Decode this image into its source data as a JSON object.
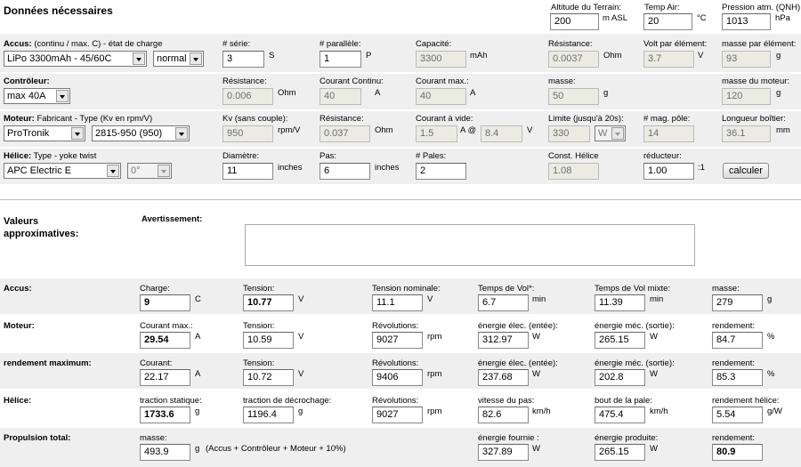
{
  "top": {
    "title": "Données nécessaires",
    "altitude_label": "Altitude du Terrain:",
    "altitude_value": "200",
    "altitude_unit": "m ASL",
    "temp_label": "Temp Air:",
    "temp_value": "20",
    "temp_unit": "°C",
    "pressure_label": "Pression atm. (QNH):",
    "pressure_value": "1013",
    "pressure_unit": "hPa"
  },
  "accus": {
    "label": "Accus:",
    "label_sub": "(continu / max. C) - état de charge",
    "battery_select": "LiPo 3300mAh - 45/60C",
    "state_select": "normal",
    "serie_label": "# série:",
    "serie_value": "3",
    "serie_unit": "S",
    "parallel_label": "# parallèle:",
    "parallel_value": "1",
    "parallel_unit": "P",
    "capacity_label": "Capacité:",
    "capacity_value": "3300",
    "capacity_unit": "mAh",
    "resistance_label": "Résistance:",
    "resistance_value": "0.0037",
    "resistance_unit": "Ohm",
    "volt_label": "Volt par élément:",
    "volt_value": "3.7",
    "volt_unit": "V",
    "mass_label": "masse par élément:",
    "mass_value": "93",
    "mass_unit": "g"
  },
  "controller": {
    "label": "Contrôleur:",
    "select": "max 40A",
    "resistance_label": "Résistance:",
    "resistance_value": "0.006",
    "resistance_unit": "Ohm",
    "current_label": "Courant Continu:",
    "current_value": "40",
    "current_unit": "A",
    "current_max_label": "Courant max.:",
    "current_max_value": "40",
    "current_max_unit": "A",
    "mass_label": "masse:",
    "mass_value": "50",
    "mass_unit": "g",
    "motor_mass_label": "masse du moteur:",
    "motor_mass_value": "120",
    "motor_mass_unit": "g"
  },
  "motor": {
    "label": "Moteur:",
    "label_sub": "Fabricant - Type (Kv en rpm/V)",
    "maker_select": "ProTronik",
    "type_select": "2815-950 (950)",
    "kv_label": "Kv (sans couple):",
    "kv_value": "950",
    "kv_unit": "rpm/V",
    "resistance_label": "Résistance:",
    "resistance_value": "0.037",
    "resistance_unit": "Ohm",
    "noload_label": "Courant à vide:",
    "noload_current": "1.5",
    "noload_at": "A @",
    "noload_voltage": "8.4",
    "noload_voltage_unit": "V",
    "limit_label": "Limite (jusqu'à 20s):",
    "limit_value": "330",
    "limit_select": "W",
    "poles_label": "# mag. pôle:",
    "poles_value": "14",
    "length_label": "Longueur boîtier:",
    "length_value": "36.1",
    "length_unit": "mm"
  },
  "prop": {
    "label": "Hélice:",
    "label_sub": "Type - yoke twist",
    "type_select": "APC Electric E",
    "twist_select": "0°",
    "diameter_label": "Diamètre:",
    "diameter_value": "11",
    "diameter_unit": "inches",
    "pitch_label": "Pas:",
    "pitch_value": "6",
    "pitch_unit": "inches",
    "blades_label": "# Pales:",
    "blades_value": "2",
    "const_label": "Const. Hélice",
    "const_value": "1.08",
    "gear_label": "réducteur:",
    "gear_value": "1.00",
    "gear_unit": ":1",
    "calc_button": "calculer"
  },
  "results": {
    "title": "Valeurs approximatives:",
    "warning_label": "Avertissement:",
    "accus": {
      "label": "Accus:",
      "charge_label": "Charge:",
      "charge_value": "9",
      "charge_unit": "C",
      "tension_label": "Tension:",
      "tension_value": "10.77",
      "tension_unit": "V",
      "nominal_label": "Tension nominale:",
      "nominal_value": "11.1",
      "nominal_unit": "V",
      "flight_label": "Temps de Vol*:",
      "flight_value": "6.7",
      "flight_unit": "min",
      "mixed_label": "Temps de Vol mixte:",
      "mixed_value": "11.39",
      "mixed_unit": "min",
      "mass_label": "masse:",
      "mass_value": "279",
      "mass_unit": "g"
    },
    "motor": {
      "label": "Moteur:",
      "current_label": "Courant max.:",
      "current_value": "29.54",
      "current_unit": "A",
      "tension_label": "Tension:",
      "tension_value": "10.59",
      "tension_unit": "V",
      "rev_label": "Révolutions:",
      "rev_value": "9027",
      "rev_unit": "rpm",
      "elec_label": "énergie élec. (entée):",
      "elec_value": "312.97",
      "elec_unit": "W",
      "mech_label": "énergie méc. (sortie):",
      "mech_value": "265.15",
      "mech_unit": "W",
      "eff_label": "rendement:",
      "eff_value": "84.7",
      "eff_unit": "%"
    },
    "maxeff": {
      "label": "rendement maximum:",
      "current_label": "Courant:",
      "current_value": "22.17",
      "current_unit": "A",
      "tension_label": "Tension:",
      "tension_value": "10.72",
      "tension_unit": "V",
      "rev_label": "Révolutions:",
      "rev_value": "9406",
      "rev_unit": "rpm",
      "elec_label": "énergie élec. (entée):",
      "elec_value": "237.68",
      "elec_unit": "W",
      "mech_label": "énergie méc. (sortie):",
      "mech_value": "202.8",
      "mech_unit": "W",
      "eff_label": "rendement:",
      "eff_value": "85.3",
      "eff_unit": "%"
    },
    "prop": {
      "label": "Hélice:",
      "static_label": "traction statique:",
      "static_value": "1733.6",
      "static_unit": "g",
      "stall_label": "traction de décrochage:",
      "stall_value": "1196.4",
      "stall_unit": "g",
      "rev_label": "Révolutions:",
      "rev_value": "9027",
      "rev_unit": "rpm",
      "pitch_speed_label": "vitesse du pas:",
      "pitch_speed_value": "82.6",
      "pitch_speed_unit": "km/h",
      "tip_label": "bout de la pale:",
      "tip_value": "475.4",
      "tip_unit": "km/h",
      "eff_label": "rendement hélice:",
      "eff_value": "5.54",
      "eff_unit": "g/W"
    },
    "total": {
      "label": "Propulsion total:",
      "mass_label": "masse:",
      "mass_value": "493.9",
      "mass_unit": "g",
      "mass_note": "(Accus + Contrôleur + Moteur + 10%)",
      "supplied_label": "énergie fournie :",
      "supplied_value": "327.89",
      "supplied_unit": "W",
      "produced_label": "énergie produite:",
      "produced_value": "265.15",
      "produced_unit": "W",
      "eff_label": "rendement:",
      "eff_value": "80.9"
    }
  }
}
